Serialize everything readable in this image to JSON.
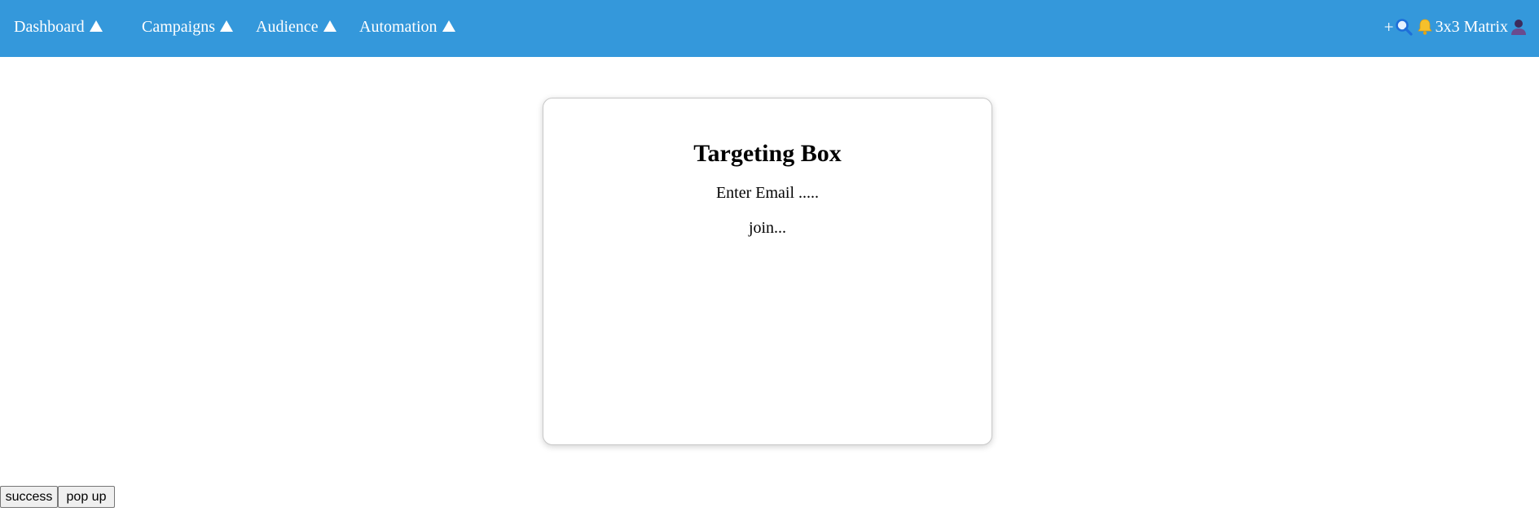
{
  "header": {
    "nav": [
      {
        "label": "Dashboard"
      },
      {
        "label": "Campaigns"
      },
      {
        "label": "Audience"
      },
      {
        "label": "Automation"
      }
    ],
    "right": {
      "plus": "+",
      "matrix_label": "3x3 Matrix"
    },
    "colors": {
      "bar": "#3498db",
      "bell": "#f6c02c",
      "search": "#1e6fd9",
      "user": "#4a3a7a"
    }
  },
  "card": {
    "title": "Targeting Box",
    "email_text": "Enter Email .....",
    "join_text": "join..."
  },
  "footer": {
    "success_label": "success",
    "popup_label": "pop up"
  }
}
